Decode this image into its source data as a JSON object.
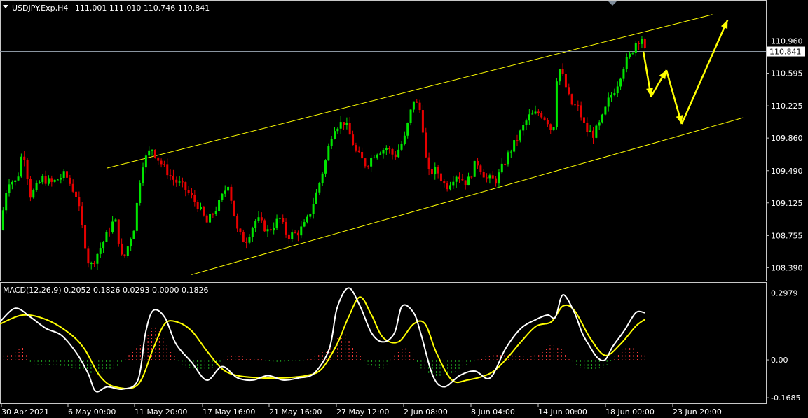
{
  "header": {
    "symbol_line": "USDJPY.Exp,H4",
    "ohlc": "111.001 111.010 110.746 110.841"
  },
  "macd_header": "MACD(12,26,9) 0.2052 0.1826 0.0293 0.0000 0.1826",
  "colors": {
    "background": "#000000",
    "bull_candle": "#00e600",
    "bear_candle": "#e60000",
    "channel": "#ffff00",
    "projection_arrow": "#ffff00",
    "macd_line": "#ffffff",
    "signal_line": "#ffff00",
    "hist_pos": "#ff3b3b",
    "hist_neg": "#1e9e1e",
    "axis_text": "#ffffff",
    "grid_border": "#c8c8c8"
  },
  "chart_data": [
    {
      "type": "candlestick",
      "name": "USDJPY.Exp,H4",
      "y_ticks": [
        "110.960",
        "110.595",
        "110.225",
        "109.860",
        "109.490",
        "109.125",
        "108.755",
        "108.390"
      ],
      "current_price": "110.841",
      "ylim": [
        108.25,
        111.25
      ],
      "x_ticks": [
        "30 Apr 2021",
        "6 May 00:00",
        "11 May 20:00",
        "17 May 16:00",
        "21 May 16:00",
        "27 May 12:00",
        "2 Jun 08:00",
        "8 Jun 04:00",
        "14 Jun 00:00",
        "18 Jun 00:00",
        "23 Jun 20:00"
      ],
      "channel_upper": [
        [
          0.14,
          109.52
        ],
        [
          0.93,
          111.26
        ]
      ],
      "channel_lower": [
        [
          0.25,
          108.31
        ],
        [
          0.97,
          110.09
        ]
      ],
      "projection_path": [
        [
          0.84,
          110.84
        ],
        [
          0.85,
          110.33
        ],
        [
          0.87,
          110.63
        ],
        [
          0.89,
          110.02
        ],
        [
          0.95,
          111.2
        ]
      ],
      "price_path": [
        [
          0.0,
          108.82
        ],
        [
          0.01,
          109.38
        ],
        [
          0.022,
          109.36
        ],
        [
          0.03,
          109.75
        ],
        [
          0.04,
          109.2
        ],
        [
          0.055,
          109.4
        ],
        [
          0.068,
          109.35
        ],
        [
          0.085,
          109.45
        ],
        [
          0.1,
          109.2
        ],
        [
          0.117,
          108.38
        ],
        [
          0.13,
          108.6
        ],
        [
          0.15,
          108.95
        ],
        [
          0.16,
          108.45
        ],
        [
          0.175,
          108.85
        ],
        [
          0.185,
          109.55
        ],
        [
          0.198,
          109.75
        ],
        [
          0.208,
          109.6
        ],
        [
          0.225,
          109.4
        ],
        [
          0.24,
          109.3
        ],
        [
          0.258,
          109.1
        ],
        [
          0.27,
          108.9
        ],
        [
          0.285,
          109.1
        ],
        [
          0.298,
          109.35
        ],
        [
          0.31,
          108.8
        ],
        [
          0.32,
          108.68
        ],
        [
          0.335,
          108.95
        ],
        [
          0.35,
          108.8
        ],
        [
          0.365,
          108.95
        ],
        [
          0.375,
          108.75
        ],
        [
          0.388,
          108.78
        ],
        [
          0.4,
          108.9
        ],
        [
          0.412,
          109.2
        ],
        [
          0.425,
          109.6
        ],
        [
          0.435,
          109.98
        ],
        [
          0.45,
          110.05
        ],
        [
          0.465,
          109.7
        ],
        [
          0.478,
          109.55
        ],
        [
          0.49,
          109.7
        ],
        [
          0.505,
          109.75
        ],
        [
          0.515,
          109.65
        ],
        [
          0.528,
          109.85
        ],
        [
          0.54,
          110.3
        ],
        [
          0.55,
          110.15
        ],
        [
          0.558,
          109.45
        ],
        [
          0.57,
          109.5
        ],
        [
          0.582,
          109.3
        ],
        [
          0.595,
          109.45
        ],
        [
          0.61,
          109.35
        ],
        [
          0.622,
          109.6
        ],
        [
          0.635,
          109.4
        ],
        [
          0.648,
          109.38
        ],
        [
          0.662,
          109.65
        ],
        [
          0.675,
          109.85
        ],
        [
          0.69,
          110.1
        ],
        [
          0.705,
          110.15
        ],
        [
          0.715,
          110.05
        ],
        [
          0.722,
          109.9
        ],
        [
          0.728,
          110.7
        ],
        [
          0.735,
          110.55
        ],
        [
          0.745,
          110.25
        ],
        [
          0.755,
          110.2
        ],
        [
          0.765,
          109.95
        ],
        [
          0.775,
          109.9
        ],
        [
          0.785,
          110.05
        ],
        [
          0.795,
          110.3
        ],
        [
          0.805,
          110.45
        ],
        [
          0.815,
          110.7
        ],
        [
          0.823,
          110.8
        ],
        [
          0.83,
          110.95
        ],
        [
          0.838,
          111.0
        ],
        [
          0.842,
          110.84
        ]
      ]
    },
    {
      "type": "macd",
      "name": "MACD(12,26,9)",
      "values": {
        "macd": 0.2052,
        "signal": 0.1826,
        "histogram": 0.0293,
        "last": 0.1826
      },
      "y_ticks": [
        "0.2979",
        "0.00",
        "-0.1685"
      ],
      "ylim": [
        -0.19,
        0.34
      ],
      "macd": [
        [
          0.0,
          0.17
        ],
        [
          0.02,
          0.23
        ],
        [
          0.04,
          0.19
        ],
        [
          0.06,
          0.14
        ],
        [
          0.08,
          0.11
        ],
        [
          0.1,
          0.03
        ],
        [
          0.115,
          -0.06
        ],
        [
          0.125,
          -0.14
        ],
        [
          0.14,
          -0.12
        ],
        [
          0.16,
          -0.13
        ],
        [
          0.18,
          -0.09
        ],
        [
          0.19,
          0.12
        ],
        [
          0.2,
          0.22
        ],
        [
          0.215,
          0.19
        ],
        [
          0.23,
          0.07
        ],
        [
          0.25,
          -0.01
        ],
        [
          0.27,
          -0.09
        ],
        [
          0.29,
          -0.03
        ],
        [
          0.31,
          -0.08
        ],
        [
          0.33,
          -0.09
        ],
        [
          0.35,
          -0.07
        ],
        [
          0.37,
          -0.09
        ],
        [
          0.39,
          -0.08
        ],
        [
          0.41,
          -0.06
        ],
        [
          0.43,
          0.05
        ],
        [
          0.44,
          0.23
        ],
        [
          0.455,
          0.32
        ],
        [
          0.47,
          0.24
        ],
        [
          0.485,
          0.12
        ],
        [
          0.5,
          0.08
        ],
        [
          0.515,
          0.12
        ],
        [
          0.525,
          0.24
        ],
        [
          0.54,
          0.21
        ],
        [
          0.55,
          0.11
        ],
        [
          0.565,
          -0.07
        ],
        [
          0.58,
          -0.12
        ],
        [
          0.6,
          -0.07
        ],
        [
          0.62,
          -0.05
        ],
        [
          0.64,
          -0.08
        ],
        [
          0.66,
          0.05
        ],
        [
          0.68,
          0.14
        ],
        [
          0.7,
          0.18
        ],
        [
          0.715,
          0.2
        ],
        [
          0.725,
          0.19
        ],
        [
          0.735,
          0.29
        ],
        [
          0.75,
          0.21
        ],
        [
          0.76,
          0.12
        ],
        [
          0.77,
          0.06
        ],
        [
          0.78,
          0.01
        ],
        [
          0.79,
          0.0
        ],
        [
          0.8,
          0.06
        ],
        [
          0.815,
          0.13
        ],
        [
          0.83,
          0.21
        ],
        [
          0.842,
          0.21
        ]
      ],
      "signal": [
        [
          0.0,
          0.16
        ],
        [
          0.03,
          0.2
        ],
        [
          0.06,
          0.18
        ],
        [
          0.09,
          0.12
        ],
        [
          0.11,
          0.05
        ],
        [
          0.13,
          -0.07
        ],
        [
          0.15,
          -0.12
        ],
        [
          0.18,
          -0.11
        ],
        [
          0.2,
          0.05
        ],
        [
          0.215,
          0.16
        ],
        [
          0.23,
          0.17
        ],
        [
          0.25,
          0.13
        ],
        [
          0.27,
          0.04
        ],
        [
          0.29,
          -0.04
        ],
        [
          0.31,
          -0.07
        ],
        [
          0.34,
          -0.08
        ],
        [
          0.37,
          -0.08
        ],
        [
          0.4,
          -0.07
        ],
        [
          0.42,
          -0.04
        ],
        [
          0.44,
          0.07
        ],
        [
          0.455,
          0.19
        ],
        [
          0.47,
          0.28
        ],
        [
          0.485,
          0.2
        ],
        [
          0.5,
          0.1
        ],
        [
          0.52,
          0.08
        ],
        [
          0.54,
          0.16
        ],
        [
          0.555,
          0.16
        ],
        [
          0.57,
          0.03
        ],
        [
          0.59,
          -0.09
        ],
        [
          0.61,
          -0.09
        ],
        [
          0.64,
          -0.06
        ],
        [
          0.66,
          0.0
        ],
        [
          0.68,
          0.08
        ],
        [
          0.7,
          0.15
        ],
        [
          0.72,
          0.17
        ],
        [
          0.735,
          0.24
        ],
        [
          0.75,
          0.22
        ],
        [
          0.77,
          0.1
        ],
        [
          0.79,
          0.02
        ],
        [
          0.81,
          0.07
        ],
        [
          0.83,
          0.15
        ],
        [
          0.842,
          0.18
        ]
      ],
      "histogram": [
        [
          0.01,
          0.02
        ],
        [
          0.02,
          0.04
        ],
        [
          0.03,
          0.06
        ],
        [
          0.04,
          -0.02
        ],
        [
          0.06,
          -0.02
        ],
        [
          0.09,
          -0.03
        ],
        [
          0.12,
          -0.06
        ],
        [
          0.15,
          -0.04
        ],
        [
          0.17,
          0.03
        ],
        [
          0.19,
          0.09
        ],
        [
          0.2,
          0.15
        ],
        [
          0.21,
          0.13
        ],
        [
          0.22,
          0.05
        ],
        [
          0.24,
          -0.03
        ],
        [
          0.27,
          -0.05
        ],
        [
          0.3,
          0.02
        ],
        [
          0.33,
          0.01
        ],
        [
          0.36,
          -0.01
        ],
        [
          0.4,
          0.0
        ],
        [
          0.43,
          0.05
        ],
        [
          0.44,
          0.1
        ],
        [
          0.45,
          0.12
        ],
        [
          0.46,
          0.06
        ],
        [
          0.48,
          -0.02
        ],
        [
          0.5,
          -0.04
        ],
        [
          0.52,
          0.04
        ],
        [
          0.53,
          0.06
        ],
        [
          0.55,
          -0.04
        ],
        [
          0.57,
          -0.08
        ],
        [
          0.59,
          -0.06
        ],
        [
          0.61,
          -0.02
        ],
        [
          0.63,
          0.01
        ],
        [
          0.65,
          0.03
        ],
        [
          0.67,
          0.02
        ],
        [
          0.69,
          0.01
        ],
        [
          0.71,
          0.04
        ],
        [
          0.72,
          0.07
        ],
        [
          0.73,
          0.06
        ],
        [
          0.75,
          -0.02
        ],
        [
          0.77,
          -0.05
        ],
        [
          0.79,
          -0.03
        ],
        [
          0.81,
          0.04
        ],
        [
          0.82,
          0.06
        ],
        [
          0.83,
          0.05
        ],
        [
          0.84,
          0.02
        ]
      ]
    }
  ]
}
